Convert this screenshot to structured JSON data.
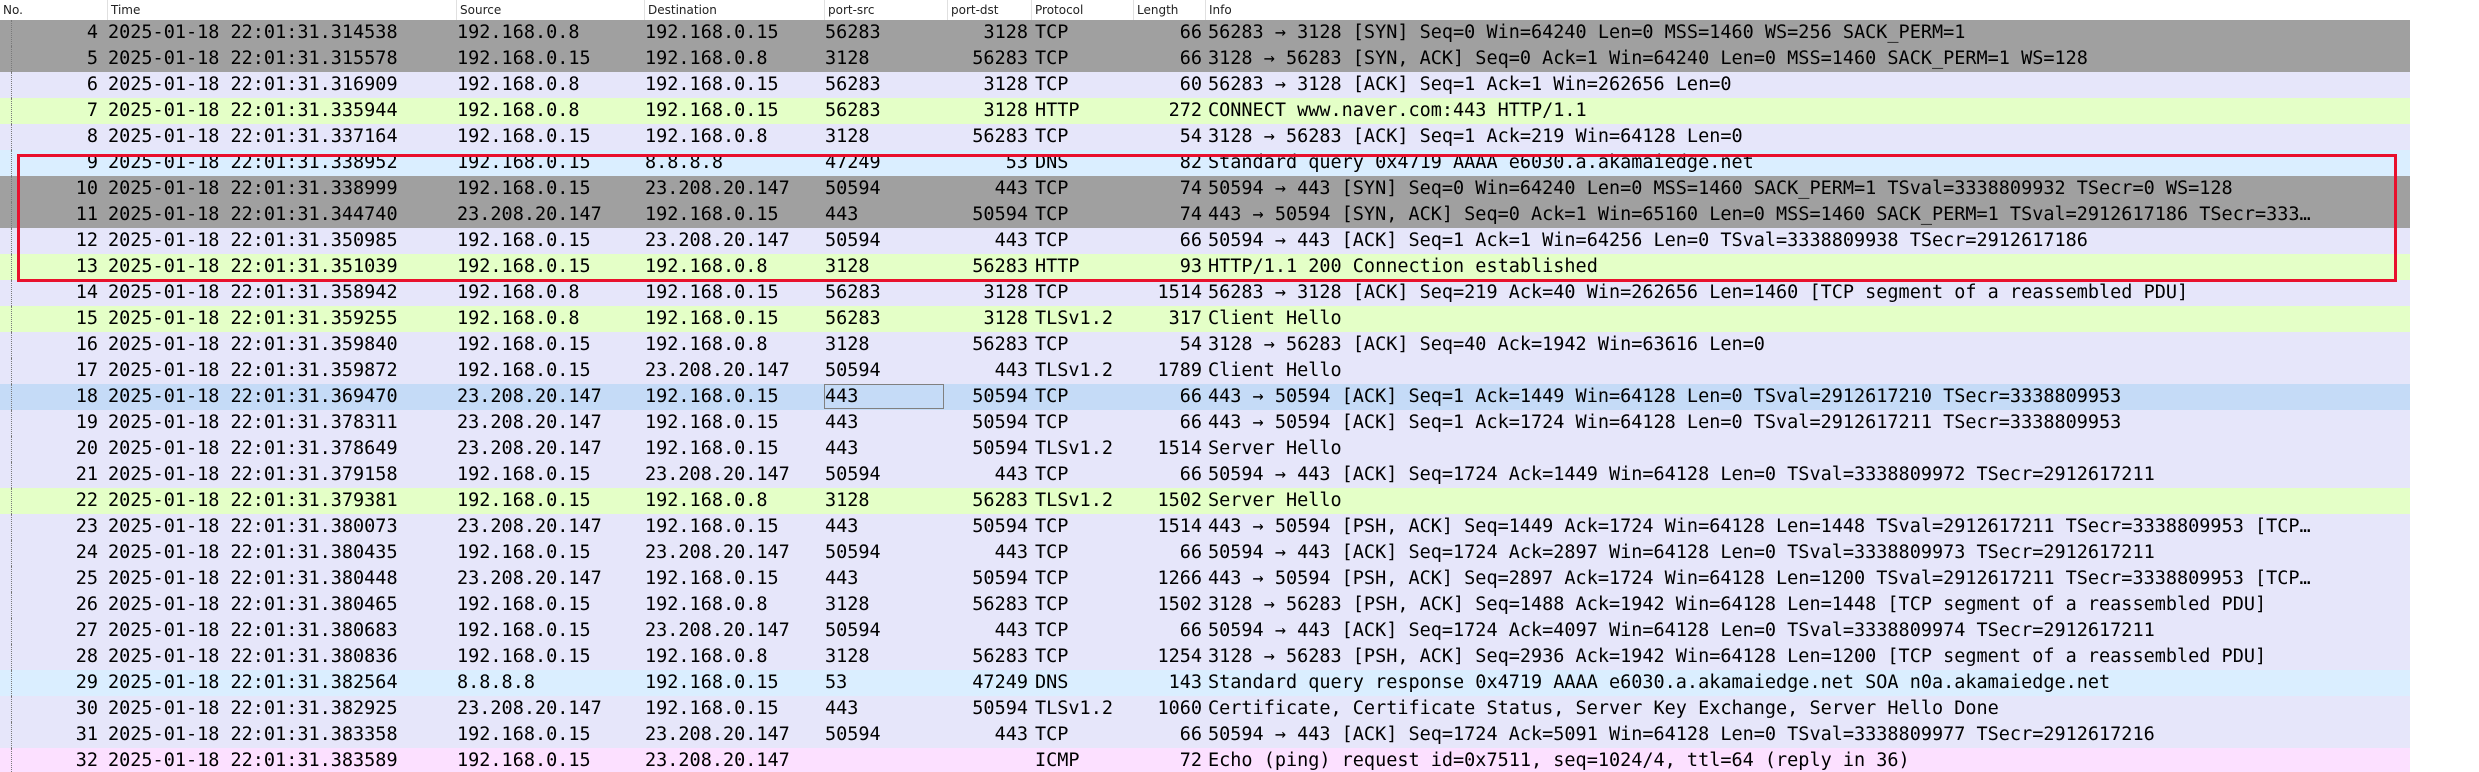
{
  "columns": [
    {
      "key": "no",
      "label": "No."
    },
    {
      "key": "time",
      "label": "Time"
    },
    {
      "key": "src",
      "label": "Source"
    },
    {
      "key": "dst",
      "label": "Destination"
    },
    {
      "key": "psrc",
      "label": "port-src"
    },
    {
      "key": "pdst",
      "label": "port-dst"
    },
    {
      "key": "proto",
      "label": "Protocol"
    },
    {
      "key": "len",
      "label": "Length"
    },
    {
      "key": "info",
      "label": "Info"
    }
  ],
  "row_colors": {
    "TCP": "#e6e6fa",
    "TCP_SYN": "#a0a0a0",
    "HTTP": "#e4ffc7",
    "DNS": "#daeeff",
    "TLS": "#e6e6fa",
    "ICMP": "#fce0ff",
    "selected_fill": "#c5dbf7"
  },
  "highlight_color": "#e8112d",
  "selected_row_no": "18",
  "packets": [
    {
      "no": "4",
      "time": "2025-01-18 22:01:31.314538",
      "src": "192.168.0.8",
      "dst": "192.168.0.15",
      "psrc": "56283",
      "pdst": "3128",
      "proto": "TCP",
      "len": "66",
      "info": "56283 → 3128 [SYN] Seq=0 Win=64240 Len=0 MSS=1460 WS=256 SACK_PERM=1",
      "color": "TCP_SYN"
    },
    {
      "no": "5",
      "time": "2025-01-18 22:01:31.315578",
      "src": "192.168.0.15",
      "dst": "192.168.0.8",
      "psrc": "3128",
      "pdst": "56283",
      "proto": "TCP",
      "len": "66",
      "info": "3128 → 56283 [SYN, ACK] Seq=0 Ack=1 Win=64240 Len=0 MSS=1460 SACK_PERM=1 WS=128",
      "color": "TCP_SYN"
    },
    {
      "no": "6",
      "time": "2025-01-18 22:01:31.316909",
      "src": "192.168.0.8",
      "dst": "192.168.0.15",
      "psrc": "56283",
      "pdst": "3128",
      "proto": "TCP",
      "len": "60",
      "info": "56283 → 3128 [ACK] Seq=1 Ack=1 Win=262656 Len=0",
      "color": "TCP"
    },
    {
      "no": "7",
      "time": "2025-01-18 22:01:31.335944",
      "src": "192.168.0.8",
      "dst": "192.168.0.15",
      "psrc": "56283",
      "pdst": "3128",
      "proto": "HTTP",
      "len": "272",
      "info": "CONNECT www.naver.com:443 HTTP/1.1",
      "color": "HTTP"
    },
    {
      "no": "8",
      "time": "2025-01-18 22:01:31.337164",
      "src": "192.168.0.15",
      "dst": "192.168.0.8",
      "psrc": "3128",
      "pdst": "56283",
      "proto": "TCP",
      "len": "54",
      "info": "3128 → 56283 [ACK] Seq=1 Ack=219 Win=64128 Len=0",
      "color": "TCP"
    },
    {
      "no": "9",
      "time": "2025-01-18 22:01:31.338952",
      "src": "192.168.0.15",
      "dst": "8.8.8.8",
      "psrc": "47249",
      "pdst": "53",
      "proto": "DNS",
      "len": "82",
      "info": "Standard query 0x4719 AAAA e6030.a.akamaiedge.net",
      "color": "DNS"
    },
    {
      "no": "10",
      "time": "2025-01-18 22:01:31.338999",
      "src": "192.168.0.15",
      "dst": "23.208.20.147",
      "psrc": "50594",
      "pdst": "443",
      "proto": "TCP",
      "len": "74",
      "info": "50594 → 443 [SYN] Seq=0 Win=64240 Len=0 MSS=1460 SACK_PERM=1 TSval=3338809932 TSecr=0 WS=128",
      "color": "TCP_SYN"
    },
    {
      "no": "11",
      "time": "2025-01-18 22:01:31.344740",
      "src": "23.208.20.147",
      "dst": "192.168.0.15",
      "psrc": "443",
      "pdst": "50594",
      "proto": "TCP",
      "len": "74",
      "info": "443 → 50594 [SYN, ACK] Seq=0 Ack=1 Win=65160 Len=0 MSS=1460 SACK_PERM=1 TSval=2912617186 TSecr=333…",
      "color": "TCP_SYN"
    },
    {
      "no": "12",
      "time": "2025-01-18 22:01:31.350985",
      "src": "192.168.0.15",
      "dst": "23.208.20.147",
      "psrc": "50594",
      "pdst": "443",
      "proto": "TCP",
      "len": "66",
      "info": "50594 → 443 [ACK] Seq=1 Ack=1 Win=64256 Len=0 TSval=3338809938 TSecr=2912617186",
      "color": "TCP"
    },
    {
      "no": "13",
      "time": "2025-01-18 22:01:31.351039",
      "src": "192.168.0.15",
      "dst": "192.168.0.8",
      "psrc": "3128",
      "pdst": "56283",
      "proto": "HTTP",
      "len": "93",
      "info": "HTTP/1.1 200 Connection established",
      "color": "HTTP"
    },
    {
      "no": "14",
      "time": "2025-01-18 22:01:31.358942",
      "src": "192.168.0.8",
      "dst": "192.168.0.15",
      "psrc": "56283",
      "pdst": "3128",
      "proto": "TCP",
      "len": "1514",
      "info": "56283 → 3128 [ACK] Seq=219 Ack=40 Win=262656 Len=1460 [TCP segment of a reassembled PDU]",
      "color": "TCP"
    },
    {
      "no": "15",
      "time": "2025-01-18 22:01:31.359255",
      "src": "192.168.0.8",
      "dst": "192.168.0.15",
      "psrc": "56283",
      "pdst": "3128",
      "proto": "TLSv1.2",
      "len": "317",
      "info": "Client Hello",
      "color": "HTTP"
    },
    {
      "no": "16",
      "time": "2025-01-18 22:01:31.359840",
      "src": "192.168.0.15",
      "dst": "192.168.0.8",
      "psrc": "3128",
      "pdst": "56283",
      "proto": "TCP",
      "len": "54",
      "info": "3128 → 56283 [ACK] Seq=40 Ack=1942 Win=63616 Len=0",
      "color": "TCP"
    },
    {
      "no": "17",
      "time": "2025-01-18 22:01:31.359872",
      "src": "192.168.0.15",
      "dst": "23.208.20.147",
      "psrc": "50594",
      "pdst": "443",
      "proto": "TLSv1.2",
      "len": "1789",
      "info": "Client Hello",
      "color": "TLS"
    },
    {
      "no": "18",
      "time": "2025-01-18 22:01:31.369470",
      "src": "23.208.20.147",
      "dst": "192.168.0.15",
      "psrc": "443",
      "pdst": "50594",
      "proto": "TCP",
      "len": "66",
      "info": "443 → 50594 [ACK] Seq=1 Ack=1449 Win=64128 Len=0 TSval=2912617210 TSecr=3338809953",
      "color": "TCP"
    },
    {
      "no": "19",
      "time": "2025-01-18 22:01:31.378311",
      "src": "23.208.20.147",
      "dst": "192.168.0.15",
      "psrc": "443",
      "pdst": "50594",
      "proto": "TCP",
      "len": "66",
      "info": "443 → 50594 [ACK] Seq=1 Ack=1724 Win=64128 Len=0 TSval=2912617211 TSecr=3338809953",
      "color": "TCP"
    },
    {
      "no": "20",
      "time": "2025-01-18 22:01:31.378649",
      "src": "23.208.20.147",
      "dst": "192.168.0.15",
      "psrc": "443",
      "pdst": "50594",
      "proto": "TLSv1.2",
      "len": "1514",
      "info": "Server Hello",
      "color": "TLS"
    },
    {
      "no": "21",
      "time": "2025-01-18 22:01:31.379158",
      "src": "192.168.0.15",
      "dst": "23.208.20.147",
      "psrc": "50594",
      "pdst": "443",
      "proto": "TCP",
      "len": "66",
      "info": "50594 → 443 [ACK] Seq=1724 Ack=1449 Win=64128 Len=0 TSval=3338809972 TSecr=2912617211",
      "color": "TCP"
    },
    {
      "no": "22",
      "time": "2025-01-18 22:01:31.379381",
      "src": "192.168.0.15",
      "dst": "192.168.0.8",
      "psrc": "3128",
      "pdst": "56283",
      "proto": "TLSv1.2",
      "len": "1502",
      "info": "Server Hello",
      "color": "HTTP"
    },
    {
      "no": "23",
      "time": "2025-01-18 22:01:31.380073",
      "src": "23.208.20.147",
      "dst": "192.168.0.15",
      "psrc": "443",
      "pdst": "50594",
      "proto": "TCP",
      "len": "1514",
      "info": "443 → 50594 [PSH, ACK] Seq=1449 Ack=1724 Win=64128 Len=1448 TSval=2912617211 TSecr=3338809953 [TCP…",
      "color": "TCP"
    },
    {
      "no": "24",
      "time": "2025-01-18 22:01:31.380435",
      "src": "192.168.0.15",
      "dst": "23.208.20.147",
      "psrc": "50594",
      "pdst": "443",
      "proto": "TCP",
      "len": "66",
      "info": "50594 → 443 [ACK] Seq=1724 Ack=2897 Win=64128 Len=0 TSval=3338809973 TSecr=2912617211",
      "color": "TCP"
    },
    {
      "no": "25",
      "time": "2025-01-18 22:01:31.380448",
      "src": "23.208.20.147",
      "dst": "192.168.0.15",
      "psrc": "443",
      "pdst": "50594",
      "proto": "TCP",
      "len": "1266",
      "info": "443 → 50594 [PSH, ACK] Seq=2897 Ack=1724 Win=64128 Len=1200 TSval=2912617211 TSecr=3338809953 [TCP…",
      "color": "TCP"
    },
    {
      "no": "26",
      "time": "2025-01-18 22:01:31.380465",
      "src": "192.168.0.15",
      "dst": "192.168.0.8",
      "psrc": "3128",
      "pdst": "56283",
      "proto": "TCP",
      "len": "1502",
      "info": "3128 → 56283 [PSH, ACK] Seq=1488 Ack=1942 Win=64128 Len=1448 [TCP segment of a reassembled PDU]",
      "color": "TCP"
    },
    {
      "no": "27",
      "time": "2025-01-18 22:01:31.380683",
      "src": "192.168.0.15",
      "dst": "23.208.20.147",
      "psrc": "50594",
      "pdst": "443",
      "proto": "TCP",
      "len": "66",
      "info": "50594 → 443 [ACK] Seq=1724 Ack=4097 Win=64128 Len=0 TSval=3338809974 TSecr=2912617211",
      "color": "TCP"
    },
    {
      "no": "28",
      "time": "2025-01-18 22:01:31.380836",
      "src": "192.168.0.15",
      "dst": "192.168.0.8",
      "psrc": "3128",
      "pdst": "56283",
      "proto": "TCP",
      "len": "1254",
      "info": "3128 → 56283 [PSH, ACK] Seq=2936 Ack=1942 Win=64128 Len=1200 [TCP segment of a reassembled PDU]",
      "color": "TCP"
    },
    {
      "no": "29",
      "time": "2025-01-18 22:01:31.382564",
      "src": "8.8.8.8",
      "dst": "192.168.0.15",
      "psrc": "53",
      "pdst": "47249",
      "proto": "DNS",
      "len": "143",
      "info": "Standard query response 0x4719 AAAA e6030.a.akamaiedge.net SOA n0a.akamaiedge.net",
      "color": "DNS"
    },
    {
      "no": "30",
      "time": "2025-01-18 22:01:31.382925",
      "src": "23.208.20.147",
      "dst": "192.168.0.15",
      "psrc": "443",
      "pdst": "50594",
      "proto": "TLSv1.2",
      "len": "1060",
      "info": "Certificate, Certificate Status, Server Key Exchange, Server Hello Done",
      "color": "TLS"
    },
    {
      "no": "31",
      "time": "2025-01-18 22:01:31.383358",
      "src": "192.168.0.15",
      "dst": "23.208.20.147",
      "psrc": "50594",
      "pdst": "443",
      "proto": "TCP",
      "len": "66",
      "info": "50594 → 443 [ACK] Seq=1724 Ack=5091 Win=64128 Len=0 TSval=3338809977 TSecr=2912617216",
      "color": "TCP"
    },
    {
      "no": "32",
      "time": "2025-01-18 22:01:31.383589",
      "src": "192.168.0.15",
      "dst": "23.208.20.147",
      "psrc": "",
      "pdst": "",
      "proto": "ICMP",
      "len": "72",
      "info": "Echo (ping) request  id=0x7511, seq=1024/4, ttl=64 (reply in 36)",
      "color": "ICMP"
    }
  ]
}
